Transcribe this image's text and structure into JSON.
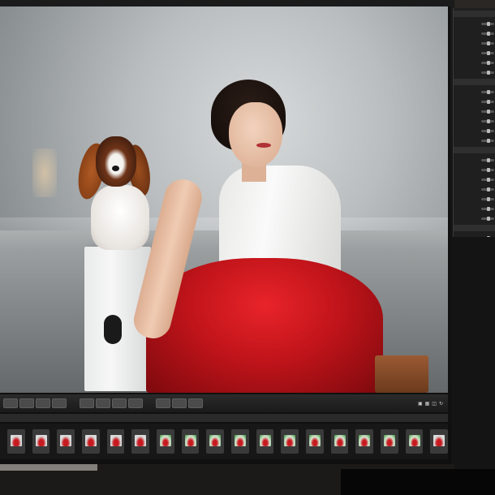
{
  "app": {
    "type": "photo-editing-viewer"
  },
  "viewer": {
    "subject": "photo",
    "palette": {
      "background": "#b9bdbf",
      "skirt": "#c0141a",
      "top": "#f2f2f0",
      "pedestal": "#eeeeee",
      "dog_ears": "#8a4218"
    }
  },
  "side_panel": {
    "sections": [
      {
        "header": "",
        "rows": [
          "",
          "",
          "",
          "",
          "",
          ""
        ]
      },
      {
        "header": "",
        "rows": [
          "",
          "",
          "",
          "",
          "",
          ""
        ]
      },
      {
        "header": "",
        "rows": [
          "",
          "",
          "",
          "",
          "",
          "",
          ""
        ]
      },
      {
        "header": "",
        "rows": [
          "",
          "",
          ""
        ]
      }
    ]
  },
  "toolbar": {
    "left_buttons": [
      "",
      "",
      "",
      ""
    ],
    "mid_buttons": [
      "",
      "",
      "",
      ""
    ],
    "right_buttons": [
      "",
      "",
      ""
    ],
    "right_icons": [
      "zoom-icon",
      "grid-icon",
      "fit-icon",
      "rotate-icon"
    ]
  },
  "filmstrip": {
    "info": "",
    "thumbnails": [
      {
        "label": "",
        "variant": "red"
      },
      {
        "label": "",
        "variant": "red"
      },
      {
        "label": "",
        "variant": "red"
      },
      {
        "label": "",
        "variant": "red"
      },
      {
        "label": "",
        "variant": "red"
      },
      {
        "label": "",
        "variant": "red"
      },
      {
        "label": "",
        "variant": "green"
      },
      {
        "label": "",
        "variant": "green"
      },
      {
        "label": "",
        "variant": "green"
      },
      {
        "label": "",
        "variant": "green"
      },
      {
        "label": "",
        "variant": "green"
      },
      {
        "label": "",
        "variant": "green"
      },
      {
        "label": "",
        "variant": "green"
      },
      {
        "label": "",
        "variant": "green"
      },
      {
        "label": "",
        "variant": "green"
      },
      {
        "label": "",
        "variant": "green"
      },
      {
        "label": "",
        "variant": "green"
      },
      {
        "label": "",
        "variant": "red"
      }
    ]
  }
}
